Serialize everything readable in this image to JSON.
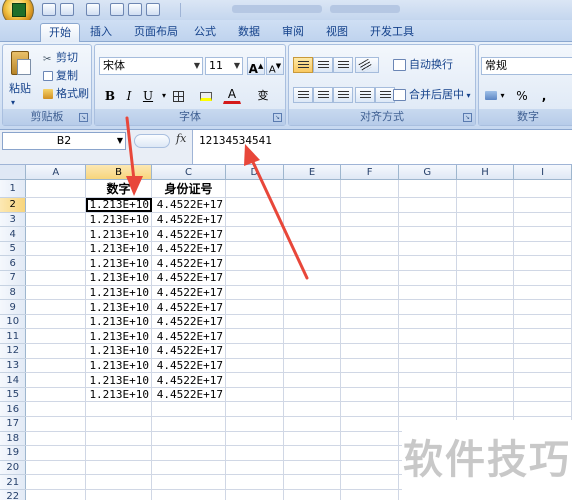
{
  "tabs": [
    "开始",
    "插入",
    "页面布局",
    "公式",
    "数据",
    "审阅",
    "视图",
    "开发工具"
  ],
  "active_tab": "开始",
  "clipboard": {
    "paste": "粘贴",
    "cut": "剪切",
    "copy": "复制",
    "format_painter": "格式刷",
    "label": "剪贴板"
  },
  "font": {
    "name": "宋体",
    "size": "11",
    "grow": "A",
    "shrink": "A",
    "bold": "B",
    "italic": "I",
    "underline": "U",
    "color_a": "A",
    "phonetic": "变",
    "label": "字体"
  },
  "alignment": {
    "wrap": "自动换行",
    "merge": "合并后居中",
    "label": "对齐方式"
  },
  "number": {
    "format": "常规",
    "currency": "¥",
    "percent": "%",
    "comma": ",",
    "label": "数字"
  },
  "formula_bar": {
    "name_box": "B2",
    "fx": "fx",
    "value": "12134534541"
  },
  "columns": [
    "A",
    "B",
    "C",
    "D",
    "E",
    "F",
    "G",
    "H",
    "I"
  ],
  "selected_column": "B",
  "selected_row": "2",
  "headers": {
    "b": "数字",
    "c": "身份证号"
  },
  "rows": [
    {
      "n": "1",
      "b": "",
      "c": ""
    },
    {
      "n": "2",
      "b": "1.213E+10",
      "c": "4.4522E+17"
    },
    {
      "n": "3",
      "b": "1.213E+10",
      "c": "4.4522E+17"
    },
    {
      "n": "4",
      "b": "1.213E+10",
      "c": "4.4522E+17"
    },
    {
      "n": "5",
      "b": "1.213E+10",
      "c": "4.4522E+17"
    },
    {
      "n": "6",
      "b": "1.213E+10",
      "c": "4.4522E+17"
    },
    {
      "n": "7",
      "b": "1.213E+10",
      "c": "4.4522E+17"
    },
    {
      "n": "8",
      "b": "1.213E+10",
      "c": "4.4522E+17"
    },
    {
      "n": "9",
      "b": "1.213E+10",
      "c": "4.4522E+17"
    },
    {
      "n": "10",
      "b": "1.213E+10",
      "c": "4.4522E+17"
    },
    {
      "n": "11",
      "b": "1.213E+10",
      "c": "4.4522E+17"
    },
    {
      "n": "12",
      "b": "1.213E+10",
      "c": "4.4522E+17"
    },
    {
      "n": "13",
      "b": "1.213E+10",
      "c": "4.4522E+17"
    },
    {
      "n": "14",
      "b": "1.213E+10",
      "c": "4.4522E+17"
    },
    {
      "n": "15",
      "b": "1.213E+10",
      "c": "4.4522E+17"
    },
    {
      "n": "16",
      "b": "",
      "c": ""
    },
    {
      "n": "17",
      "b": "",
      "c": ""
    },
    {
      "n": "18",
      "b": "",
      "c": ""
    },
    {
      "n": "19",
      "b": "",
      "c": ""
    },
    {
      "n": "20",
      "b": "",
      "c": ""
    },
    {
      "n": "21",
      "b": "",
      "c": ""
    },
    {
      "n": "22",
      "b": "",
      "c": ""
    }
  ],
  "watermark": "软件技巧",
  "colors": {
    "arrow": "#e8473a",
    "highlight": "#f8d57c",
    "ribbon": "#d4e2f4"
  }
}
